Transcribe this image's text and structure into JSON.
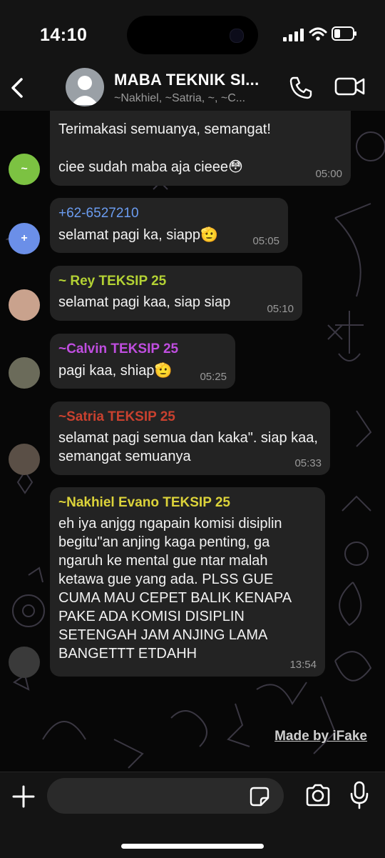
{
  "status": {
    "time": "14:10"
  },
  "header": {
    "title": "MABA TEKNIK SI...",
    "subtitle": "~Nakhiel, ~Satria, ~, ~C..."
  },
  "messages": [
    {
      "sender": "",
      "sender_color": "#ffffff",
      "avatar": "~",
      "avatar_color": "#7cc242",
      "text": "Terimakasi semuanya, semangat!\n\nciee sudah maba aja cieee",
      "emoji": "😳",
      "time": "05:00"
    },
    {
      "sender": "+62-6527210",
      "sender_color": "#6b9cf0",
      "avatar": "+",
      "avatar_color": "#6b8fe8",
      "text": "selamat pagi ka, siapp",
      "emoji": "🫡",
      "time": "05:05"
    },
    {
      "sender": "~ Rey TEKSIP 25",
      "sender_color": "#b4d234",
      "avatar": "",
      "avatar_color": "#c9a28d",
      "text": "selamat pagi kaa, siap siap",
      "emoji": "",
      "time": "05:10"
    },
    {
      "sender": "~Calvin TEKSIP 25",
      "sender_color": "#c04ee0",
      "avatar": "",
      "avatar_color": "#6b6b5a",
      "text": "pagi kaa, shiap",
      "emoji": "🫡",
      "time": "05:25"
    },
    {
      "sender": "~Satria TEKSIP 25",
      "sender_color": "#c9412f",
      "avatar": "",
      "avatar_color": "#5a4f46",
      "text": "selamat pagi semua dan kaka\". siap kaa, semangat semuanya",
      "emoji": "",
      "time": "05:33"
    },
    {
      "sender": "~Nakhiel Evano TEKSIP 25",
      "sender_color": "#dcd33a",
      "avatar": "",
      "avatar_color": "#3a3a3a",
      "text": "eh iya anjgg ngapain komisi disiplin begitu\"an anjing kaga penting, ga ngaruh ke mental gue ntar malah ketawa gue yang ada. PLSS GUE CUMA MAU CEPET BALIK KENAPA PAKE ADA KOMISI DISIPLIN SETENGAH JAM ANJING LAMA BANGETTT ETDAHH",
      "emoji": "",
      "time": "13:54"
    }
  ],
  "watermark": "Made by iFake",
  "composer": {
    "value": ""
  },
  "icons": [
    "back-icon",
    "call-icon",
    "video-icon",
    "plus-icon",
    "sticker-icon",
    "camera-icon",
    "mic-icon"
  ]
}
